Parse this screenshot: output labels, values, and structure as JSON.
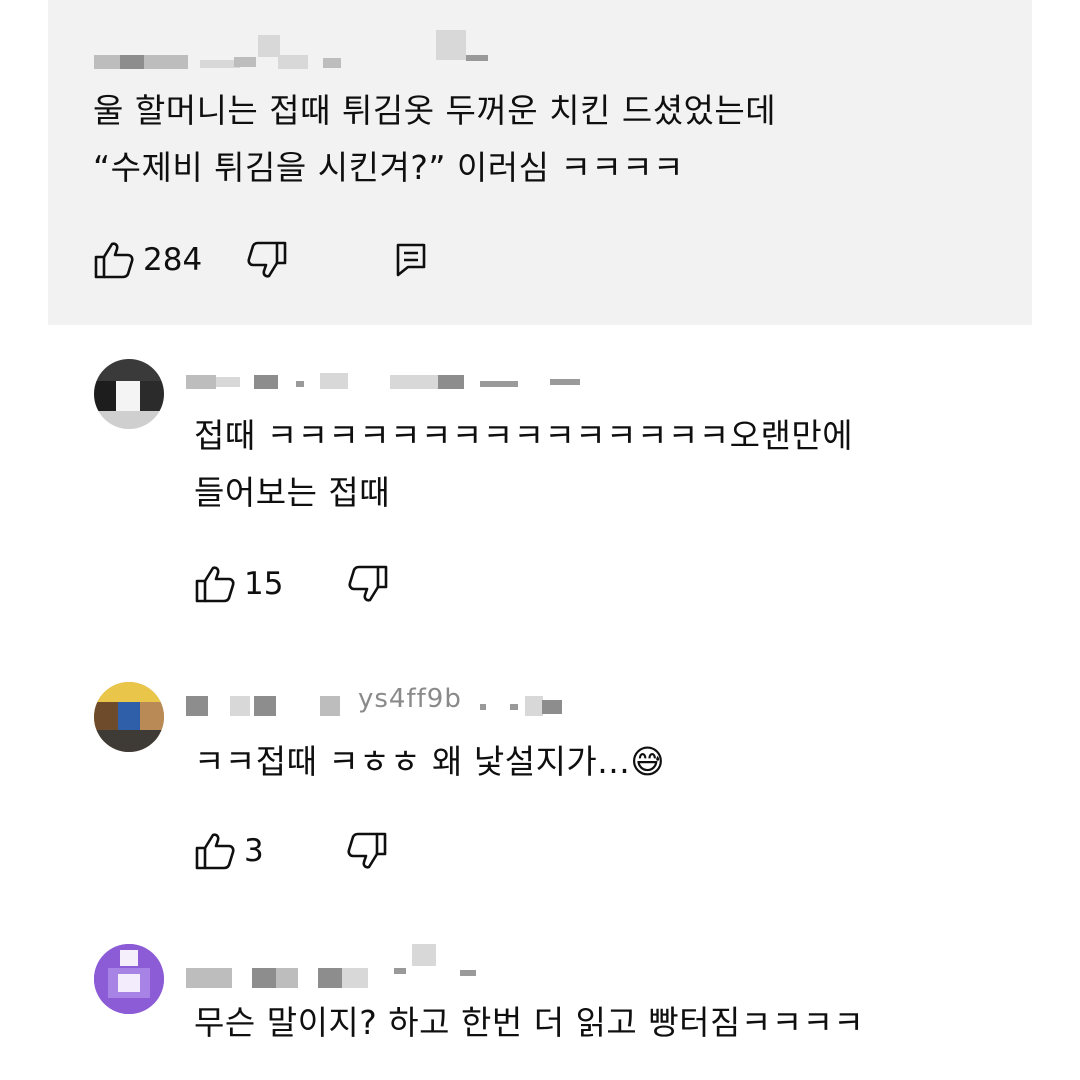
{
  "comments": [
    {
      "text_lines": [
        "울 할머니는 접때 튀김옷 두꺼운 치킨 드셨었는데",
        "“수제비 튀김을 시킨겨?” 이러심 ㅋㅋㅋㅋ"
      ],
      "likes": "284"
    },
    {
      "text_lines": [
        "접때 ㅋㅋㅋㅋㅋㅋㅋㅋㅋㅋㅋㅋㅋㅋㅋ오랜만에",
        "들어보는 접때"
      ],
      "likes": "15"
    },
    {
      "handle_fragment": "ys4ff9b",
      "text_lines": [
        "ㅋㅋ접때 ㅋㅎㅎ 왜 낯설지가...😅"
      ],
      "likes": "3"
    },
    {
      "text_lines": [
        "무슨 말이지? 하고 한번 더 읽고 빵터짐ㅋㅋㅋㅋ"
      ]
    }
  ],
  "colors": {
    "highlight_bg": "#f2f2f2",
    "text": "#0f0f0f",
    "icon": "#0f0f0f",
    "avatar_purple": "#8c5cd6"
  },
  "icons": [
    "thumbs-up-icon",
    "thumbs-down-icon",
    "reply-icon"
  ]
}
